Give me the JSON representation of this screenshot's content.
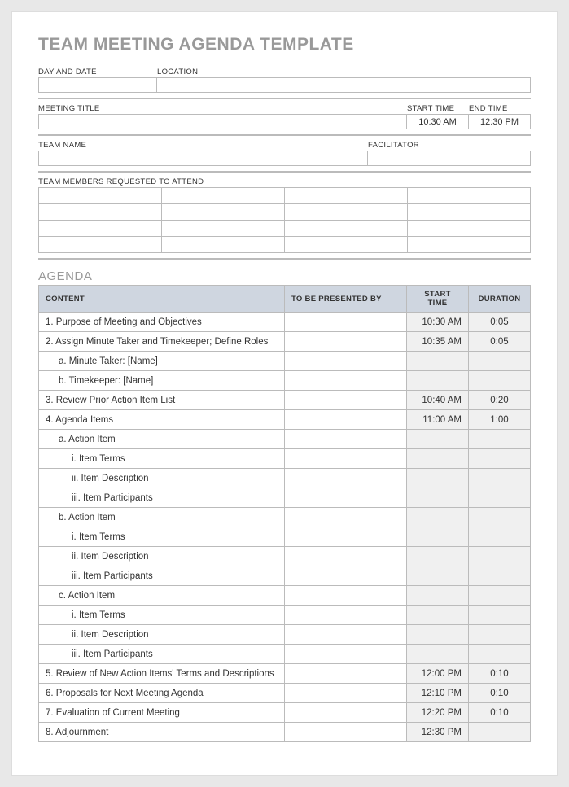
{
  "title": "TEAM MEETING AGENDA TEMPLATE",
  "labels": {
    "dayDate": "DAY AND DATE",
    "location": "LOCATION",
    "meetingTitle": "MEETING TITLE",
    "startTime": "START TIME",
    "endTime": "END TIME",
    "teamName": "TEAM NAME",
    "facilitator": "FACILITATOR",
    "members": "TEAM MEMBERS REQUESTED TO ATTEND"
  },
  "values": {
    "dayDate": "",
    "location": "",
    "meetingTitle": "",
    "startTime": "10:30 AM",
    "endTime": "12:30 PM",
    "teamName": "",
    "facilitator": ""
  },
  "agendaTitle": "AGENDA",
  "columns": {
    "content": "CONTENT",
    "presentedBy": "TO BE PRESENTED BY",
    "start": "START TIME",
    "duration": "DURATION"
  },
  "rows": [
    {
      "content": "1. Purpose of Meeting and Objectives",
      "indent": 0,
      "start": "10:30 AM",
      "dur": "0:05"
    },
    {
      "content": "2. Assign Minute Taker and Timekeeper; Define Roles",
      "indent": 0,
      "start": "10:35 AM",
      "dur": "0:05"
    },
    {
      "content": "a. Minute Taker: [Name]",
      "indent": 1,
      "start": "",
      "dur": ""
    },
    {
      "content": "b. Timekeeper: [Name]",
      "indent": 1,
      "start": "",
      "dur": ""
    },
    {
      "content": "3. Review Prior Action Item List",
      "indent": 0,
      "start": "10:40 AM",
      "dur": "0:20"
    },
    {
      "content": "4. Agenda Items",
      "indent": 0,
      "start": "11:00 AM",
      "dur": "1:00"
    },
    {
      "content": "a. Action Item",
      "indent": 1,
      "start": "",
      "dur": ""
    },
    {
      "content": "i. Item Terms",
      "indent": 2,
      "start": "",
      "dur": ""
    },
    {
      "content": "ii. Item Description",
      "indent": 2,
      "start": "",
      "dur": ""
    },
    {
      "content": "iii. Item Participants",
      "indent": 2,
      "start": "",
      "dur": ""
    },
    {
      "content": "b. Action Item",
      "indent": 1,
      "start": "",
      "dur": ""
    },
    {
      "content": "i. Item Terms",
      "indent": 2,
      "start": "",
      "dur": ""
    },
    {
      "content": "ii. Item Description",
      "indent": 2,
      "start": "",
      "dur": ""
    },
    {
      "content": "iii. Item Participants",
      "indent": 2,
      "start": "",
      "dur": ""
    },
    {
      "content": "c. Action Item",
      "indent": 1,
      "start": "",
      "dur": ""
    },
    {
      "content": "i. Item Terms",
      "indent": 2,
      "start": "",
      "dur": ""
    },
    {
      "content": "ii. Item Description",
      "indent": 2,
      "start": "",
      "dur": ""
    },
    {
      "content": "iii. Item Participants",
      "indent": 2,
      "start": "",
      "dur": ""
    },
    {
      "content": "5. Review of New Action Items' Terms and Descriptions",
      "indent": 0,
      "start": "12:00 PM",
      "dur": "0:10"
    },
    {
      "content": "6. Proposals for Next Meeting Agenda",
      "indent": 0,
      "start": "12:10 PM",
      "dur": "0:10"
    },
    {
      "content": "7. Evaluation of Current Meeting",
      "indent": 0,
      "start": "12:20 PM",
      "dur": "0:10"
    },
    {
      "content": "8. Adjournment",
      "indent": 0,
      "start": "12:30 PM",
      "dur": ""
    }
  ]
}
